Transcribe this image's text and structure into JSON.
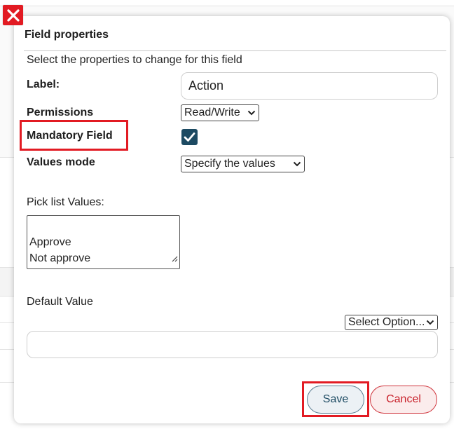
{
  "dialog": {
    "title": "Field properties",
    "subtitle": "Select the properties to change for this field",
    "label_field": {
      "label": "Label:",
      "value": "Action"
    },
    "permissions": {
      "label": "Permissions",
      "selected": "Read/Write"
    },
    "mandatory": {
      "label": "Mandatory Field",
      "checked": true
    },
    "values_mode": {
      "label": "Values mode",
      "selected": "Specify the values"
    },
    "pick_list": {
      "label": "Pick list Values:",
      "values": [
        "Approve",
        "Not approve"
      ]
    },
    "default_value": {
      "label": "Default Value",
      "select_placeholder": "Select Option...",
      "value": ""
    },
    "buttons": {
      "save": "Save",
      "cancel": "Cancel"
    }
  },
  "icons": {
    "close": "close-icon",
    "check": "checkmark-icon",
    "chevron": "chevron-down-icon",
    "resize": "resize-grip-icon"
  },
  "colors": {
    "accent": "#1c4a62",
    "highlight": "#e21b23",
    "cancel": "#c81e28"
  }
}
